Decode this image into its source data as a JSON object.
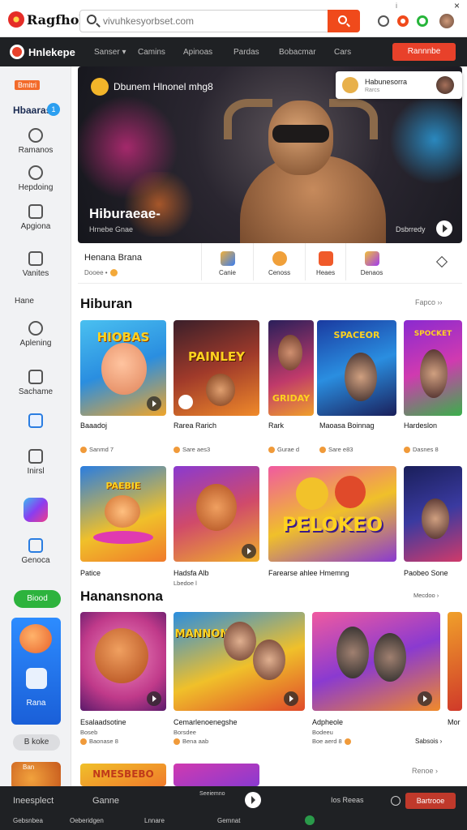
{
  "header": {
    "brand": "Ragfhob",
    "search_placeholder": "vivuhkesyorbset.com",
    "win_info": "i",
    "win_close": "×"
  },
  "nav": {
    "logo": "Hnlekepe",
    "links": [
      "Sanser ▾",
      "Camins",
      "Apinoas",
      "Pardas",
      "Bobacmar",
      "Cars"
    ],
    "cta": "Rannnbe"
  },
  "sidebar": {
    "tag": "Bmitri",
    "top_label": "Hbaaras",
    "badge": "1",
    "items": [
      "Ramanos",
      "Hepdoing",
      "Apgiona",
      "Vanites",
      "Hane",
      "Aplening",
      "Sachame",
      "Inirsl",
      "Genoca"
    ],
    "green_pill": "Biood",
    "promo_label": "Rana",
    "pill": "B koke",
    "card_label": "Ban"
  },
  "hero": {
    "headline": "Dbunem Hlnonel mhg8",
    "title": "Hiburaeae-",
    "subtitle": "Hrnebe Gnae",
    "side_text": "Dsbrredy",
    "popup_title": "Habunesorra",
    "popup_sub": "Rarcs"
  },
  "strip": {
    "name": "Henana  Brana",
    "meta": "Dooee  •",
    "categories": [
      "Canie",
      "Cenoss",
      "Heaes",
      "Denaos"
    ]
  },
  "section1": {
    "title": "Hiburan",
    "more": "Fapco ››",
    "row1": [
      {
        "name": "Baaadoj",
        "meta": "Sanmd 7",
        "word": "HIOBAS"
      },
      {
        "name": "Rarea Rarich",
        "meta": "Sare aes3",
        "word": "PAINLEY"
      },
      {
        "name": "Rark",
        "meta": "Gurae d",
        "word": "GRIDAY"
      },
      {
        "name": "Maoasa Boinnag",
        "meta": "Sare e83",
        "word": "SPACEOR"
      },
      {
        "name": "Hardeslon",
        "meta": "Dasnes 8",
        "word": "SPOCKET"
      }
    ],
    "row2": [
      {
        "name": "Patice",
        "word": "PAEBIE"
      },
      {
        "name": "Hadsfa Alb",
        "meta": "Lbedoe l",
        "word": ""
      },
      {
        "name": "Farearse ahlee Hmemng",
        "word": "PELOKEO"
      },
      {
        "name": "Paobeo Sone",
        "meta": "Mecdoo ›",
        "word": ""
      }
    ]
  },
  "section2": {
    "title": "Hanansnona",
    "row": [
      {
        "name": "Esalaadsotine",
        "meta": "Boseb",
        "meta2": "Baonase 8",
        "word": ""
      },
      {
        "name": "Cemarlenoenegshe",
        "meta": "Borsdee",
        "meta2": "Bena aab",
        "word": "MANNON"
      },
      {
        "name": "Adpheole",
        "meta": "Bodeeu",
        "meta2": "Boe aerd 8",
        "word": ""
      },
      {
        "name": "Mor",
        "word": ""
      }
    ],
    "side_text": "Sabsois ›"
  },
  "section3": {
    "more": "Renoe ›",
    "word": "NMESBEBO"
  },
  "bottombar": {
    "row1": [
      "Ineesplect",
      "Ganne",
      "Seeiemno",
      "Ios Reeas"
    ],
    "row2": [
      "Gebsnbea",
      "Oeberidgen",
      "Lnnare",
      "Gemnat"
    ],
    "cta": "Bartrooe"
  },
  "colors": {
    "accent": "#f04a1b",
    "nav_bg": "#1f2124",
    "sidebar_bg": "#f1f2f4",
    "green": "#2db33d",
    "blue": "#2d8cff"
  }
}
